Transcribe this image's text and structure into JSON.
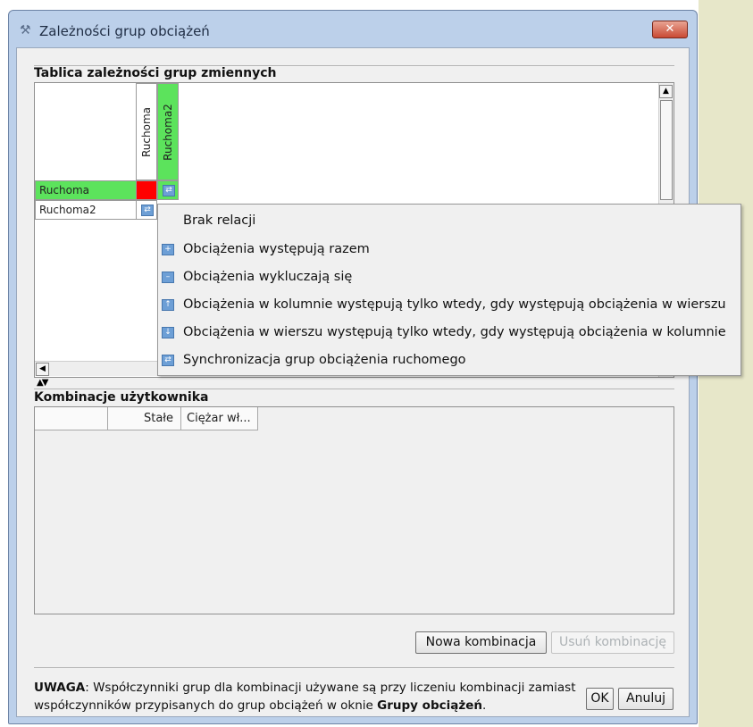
{
  "window": {
    "title": "Zależności grup obciążeń",
    "close_glyph": "✕"
  },
  "variable_groups": {
    "title": "Tablica zależności grup zmiennych",
    "columns": [
      "Ruchoma",
      "Ruchoma2"
    ],
    "rows": [
      "Ruchoma",
      "Ruchoma2"
    ],
    "colors": {
      "highlight": "#5ce35c",
      "self_cell": "#ff0000"
    }
  },
  "context_menu": {
    "items": [
      {
        "label": "Brak relacji",
        "icon": ""
      },
      {
        "label": "Obciążenia występują razem",
        "icon": "plus-icon"
      },
      {
        "label": "Obciążenia wykluczają się",
        "icon": "minus-icon"
      },
      {
        "label": "Obciążenia w kolumnie występują tylko wtedy, gdy występują obciążenia w wierszu",
        "icon": "column-depends-icon"
      },
      {
        "label": "Obciążenia w wierszu występują tylko wtedy, gdy występują obciążenia w kolumnie",
        "icon": "row-depends-icon"
      },
      {
        "label": "Synchronizacja grup obciążenia ruchomego",
        "icon": "sync-icon"
      }
    ]
  },
  "user_combinations": {
    "title": "Kombinacje użytkownika",
    "columns": [
      "",
      "Stałe",
      "Ciężar wł..."
    ]
  },
  "buttons": {
    "new_combination": "Nowa kombinacja",
    "delete_combination": "Usuń kombinację",
    "ok": "OK",
    "cancel": "Anuluj"
  },
  "note": {
    "label": "UWAGA",
    "text_before": ": Współczynniki grup dla kombinacji używane są przy liczeniu kombinacji zamiast współczynników przypisanych do grup obciążeń w oknie ",
    "emphasis": "Grupy obciążeń",
    "text_after": "."
  }
}
